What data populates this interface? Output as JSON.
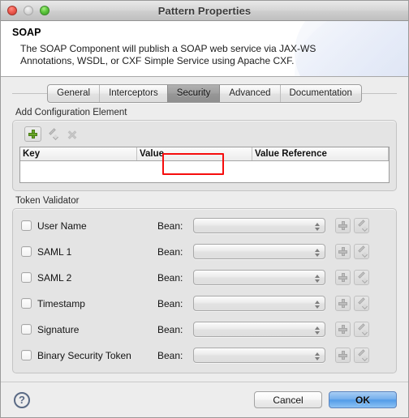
{
  "window": {
    "title": "Pattern Properties",
    "traffic_lights": [
      "close-button",
      "minimize-button",
      "zoom-button"
    ]
  },
  "header": {
    "title": "SOAP",
    "description": "The SOAP Component will publish a SOAP web service via JAX-WS Annotations, WSDL, or CXF Simple Service using Apache CXF."
  },
  "tabs": [
    {
      "label": "General",
      "selected": false
    },
    {
      "label": "Interceptors",
      "selected": false
    },
    {
      "label": "Security",
      "selected": true
    },
    {
      "label": "Advanced",
      "selected": false
    },
    {
      "label": "Documentation",
      "selected": false
    }
  ],
  "annotation": {
    "highlight_color": "#f60d0d",
    "target": "Security"
  },
  "config_section": {
    "label": "Add Configuration Element",
    "toolbar": [
      {
        "name": "add-button",
        "icon": "plus-icon",
        "enabled": true
      },
      {
        "name": "edit-button",
        "icon": "pencil-icon",
        "enabled": false
      },
      {
        "name": "delete-button",
        "icon": "delete-icon",
        "enabled": false
      }
    ],
    "table": {
      "columns": [
        "Key",
        "Value",
        "Value Reference"
      ],
      "rows": []
    }
  },
  "token_validator": {
    "label": "Token Validator",
    "bean_label": "Bean:",
    "rows": [
      {
        "name": "User Name",
        "checked": false,
        "bean_value": ""
      },
      {
        "name": "SAML 1",
        "checked": false,
        "bean_value": ""
      },
      {
        "name": "SAML 2",
        "checked": false,
        "bean_value": ""
      },
      {
        "name": "Timestamp",
        "checked": false,
        "bean_value": ""
      },
      {
        "name": "Signature",
        "checked": false,
        "bean_value": ""
      },
      {
        "name": "Binary Security Token",
        "checked": false,
        "bean_value": ""
      }
    ]
  },
  "footer": {
    "help": "?",
    "cancel_label": "Cancel",
    "ok_label": "OK",
    "ok_accent": "#539ce8"
  }
}
